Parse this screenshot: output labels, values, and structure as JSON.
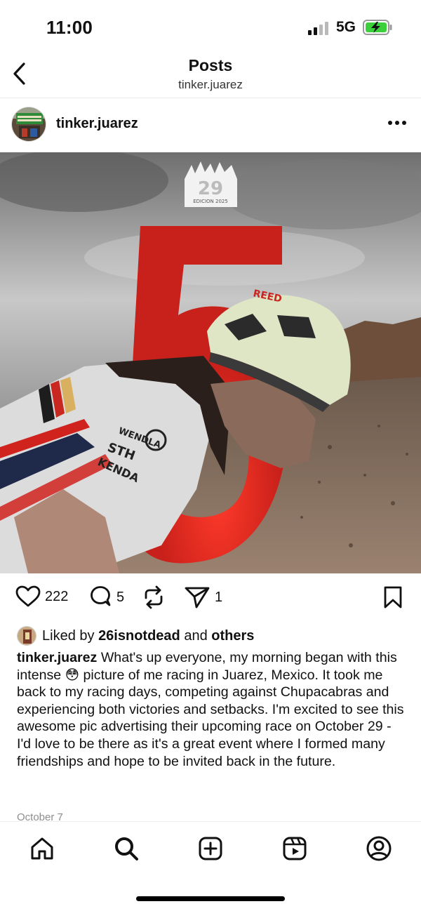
{
  "status_bar": {
    "time": "11:00",
    "network": "5G",
    "icons": [
      "cellular-signal-icon",
      "battery-charging-icon"
    ]
  },
  "header": {
    "title": "Posts",
    "subtitle": "tinker.juarez",
    "back_icon": "chevron-left-icon"
  },
  "post": {
    "author": "tinker.juarez",
    "more_icon": "more-horizontal-icon",
    "image": {
      "poster_big_numeral": "5",
      "logo_text": "EDICION 2025",
      "jersey_text": [
        "WENDLA",
        "STH",
        "KENDA"
      ],
      "helmet_text": "REED"
    },
    "actions": {
      "likes": "222",
      "comments": "5",
      "shares": "1"
    },
    "liked_by": {
      "prefix": "Liked by",
      "user": "26isnotdead",
      "conjunction": "and",
      "others": "others"
    },
    "caption": {
      "author": "tinker.juarez",
      "text_before_emoji": "What's up everyone, my morning began with this intense",
      "emoji": "😳",
      "text_after_emoji": "picture of me racing in Juarez, Mexico. It took me back to my racing days, competing against Chupacabras and experiencing both victories and setbacks. I'm excited to see this awesome pic advertising their upcoming race on October 29 - I'd love to be there as it's a great event where I formed many friendships and hope to be invited back in the future."
    },
    "date": "October 7"
  },
  "bottom_nav": {
    "items": [
      "home-icon",
      "search-icon",
      "create-icon",
      "reels-icon",
      "profile-icon"
    ]
  },
  "colors": {
    "accent_red": "#e8281f",
    "battery_green": "#3ccf3c",
    "muted_text": "#8e8e8e"
  }
}
